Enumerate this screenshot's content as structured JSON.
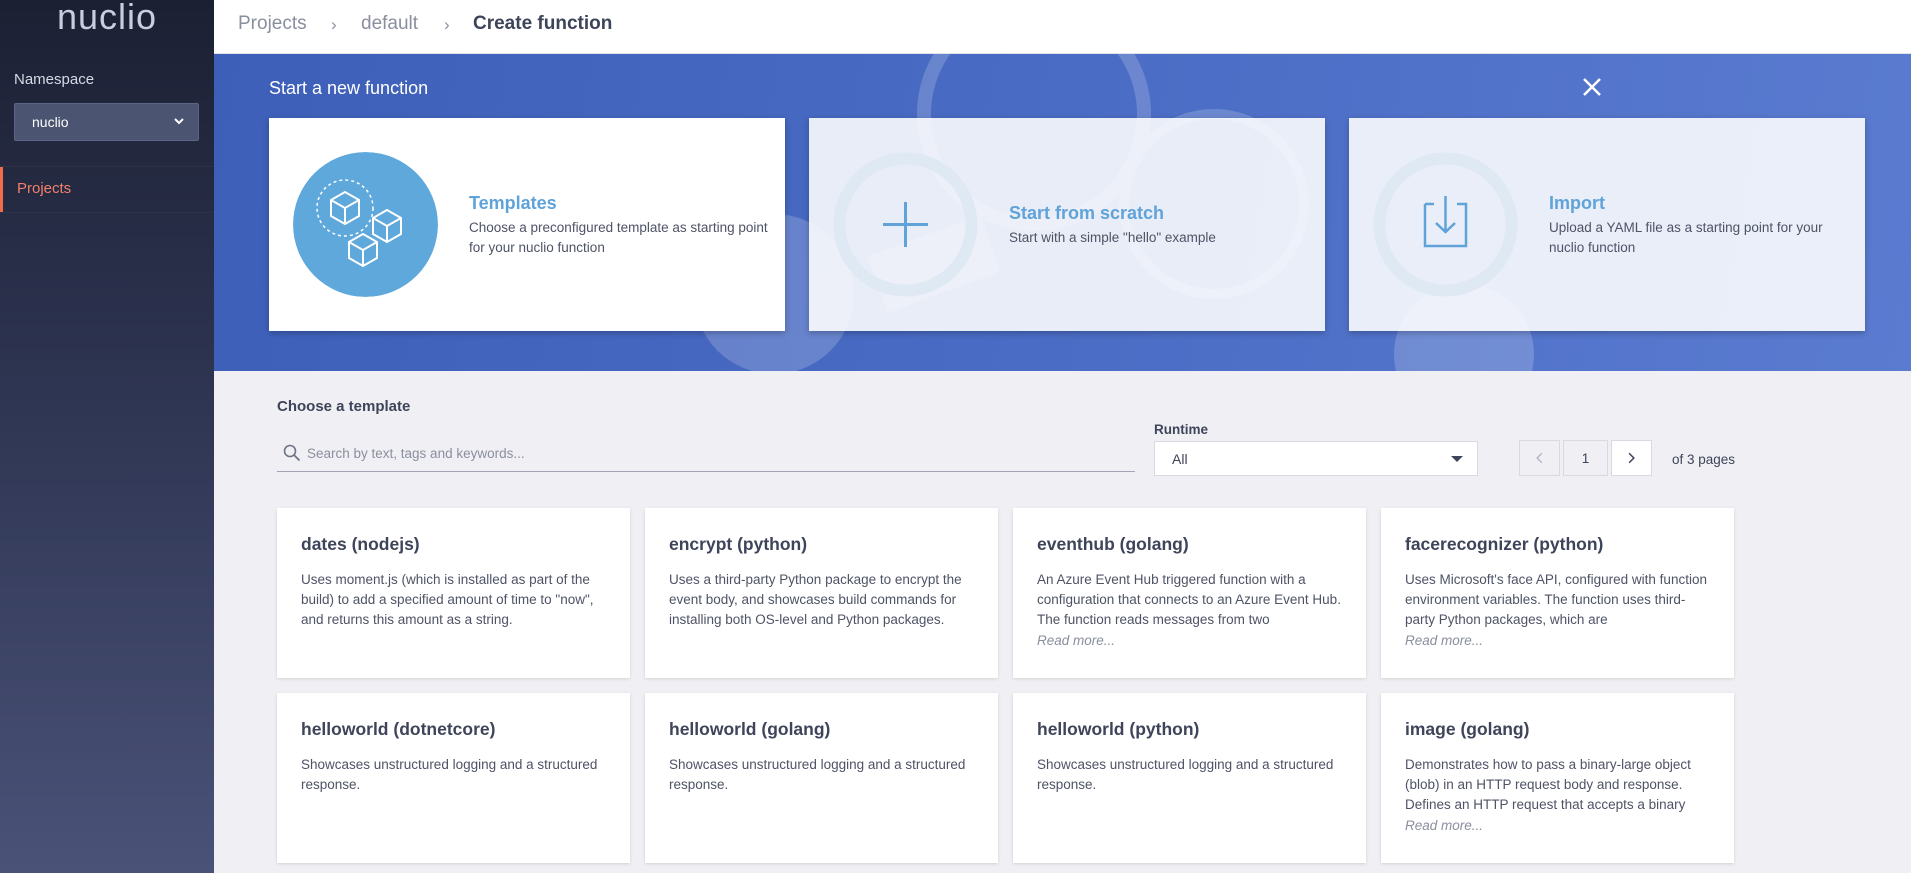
{
  "sidebar": {
    "logo": "nuclio",
    "namespace_label": "Namespace",
    "namespace_value": "nuclio",
    "nav_items": [
      {
        "label": "Projects",
        "active": true
      }
    ]
  },
  "breadcrumb": [
    "Projects",
    "default",
    "Create function"
  ],
  "banner": {
    "title": "Start a new function",
    "options": [
      {
        "title": "Templates",
        "description": "Choose a preconfigured template as starting point for your nuclio function",
        "icon": "cubes-icon"
      },
      {
        "title": "Start from scratch",
        "description": "Start with a simple \"hello\" example",
        "icon": "plus-icon"
      },
      {
        "title": "Import",
        "description": "Upload a YAML file as a starting point for your nuclio function",
        "icon": "download-icon"
      }
    ]
  },
  "templates": {
    "heading": "Choose a template",
    "search_placeholder": "Search by text, tags and keywords...",
    "runtime_label": "Runtime",
    "runtime_value": "All",
    "pagination": {
      "current": "1",
      "total_text": "of 3 pages"
    },
    "read_more": "Read more...",
    "cards": [
      {
        "title": "dates (nodejs)",
        "description": "Uses moment.js (which is installed as part of the build) to add a specified amount of time to \"now\", and returns this amount as a string.",
        "read_more": false
      },
      {
        "title": "encrypt (python)",
        "description": "Uses a third-party Python package to encrypt the event body, and showcases build commands for installing both OS-level and Python packages.",
        "read_more": false
      },
      {
        "title": "eventhub (golang)",
        "description": "An Azure Event Hub triggered function with a configuration that connects to an Azure Event Hub. The function reads messages from two",
        "read_more": true
      },
      {
        "title": "facerecognizer (python)",
        "description": "Uses Microsoft's face API, configured with function environment variables. The function uses third-party Python packages, which are",
        "read_more": true
      },
      {
        "title": "helloworld (dotnetcore)",
        "description": "Showcases unstructured logging and a structured response.",
        "read_more": false
      },
      {
        "title": "helloworld (golang)",
        "description": "Showcases unstructured logging and a structured response.",
        "read_more": false
      },
      {
        "title": "helloworld (python)",
        "description": "Showcases unstructured logging and a structured response.",
        "read_more": false
      },
      {
        "title": "image (golang)",
        "description": "Demonstrates how to pass a binary-large object (blob) in an HTTP request body and response. Defines an HTTP request that accepts a binary",
        "read_more": true
      }
    ]
  },
  "colors": {
    "accent": "#f06d4c",
    "link": "#5fa3d9",
    "banner": "#4a6cc4"
  }
}
